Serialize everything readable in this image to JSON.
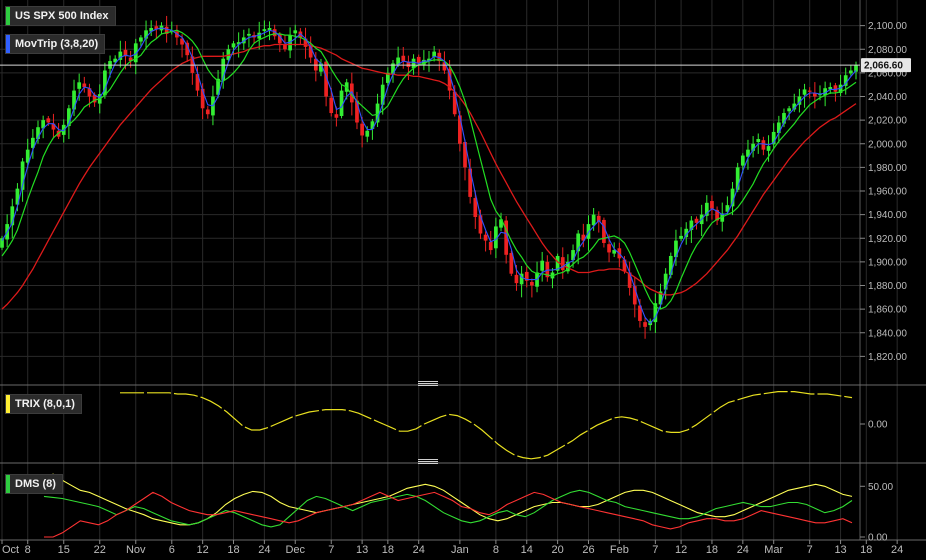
{
  "chart_data": [
    {
      "type": "candlestick",
      "title": "US SPX 500 Index",
      "overlay": "MovTrip (3,8,20)",
      "ylim": [
        1800,
        2120
      ],
      "yticks": [
        1820,
        1840,
        1860,
        1880,
        1900,
        1920,
        1940,
        1960,
        1980,
        2000,
        2020,
        2040,
        2060,
        2080,
        2100
      ],
      "ytick_labels": [
        "1,820.00",
        "1,840.00",
        "1,860.00",
        "1,880.00",
        "1,900.00",
        "1,920.00",
        "1,940.00",
        "1,960.00",
        "1,980.00",
        "2,000.00",
        "2,020.00",
        "2,040.00",
        "2,060.00",
        "2,080.00",
        "2,100.00"
      ],
      "last_price": 2066.6,
      "last_price_label": "2,066.60",
      "x_labels": [
        "Oct",
        "8",
        "15",
        "22",
        "Nov",
        "6",
        "12",
        "18",
        "24",
        "Dec",
        "7",
        "13",
        "18",
        "24",
        "Jan",
        "8",
        "14",
        "20",
        "26",
        "Feb",
        "7",
        "12",
        "18",
        "24",
        "Mar",
        "7",
        "13",
        "18",
        "24"
      ],
      "x_label_bar_index": [
        0,
        5,
        12,
        19,
        26,
        33,
        39,
        45,
        51,
        57,
        64,
        70,
        75,
        81,
        89,
        96,
        102,
        108,
        114,
        120,
        127,
        132,
        138,
        144,
        150,
        157,
        163,
        168,
        174
      ],
      "close": [
        1920,
        1932,
        1947,
        1962,
        1985,
        1995,
        2005,
        2014,
        2020,
        2018,
        2012,
        2006,
        2016,
        2030,
        2045,
        2052,
        2048,
        2040,
        2035,
        2042,
        2062,
        2070,
        2072,
        2078,
        2074,
        2070,
        2085,
        2090,
        2096,
        2098,
        2097,
        2100,
        2093,
        2096,
        2090,
        2084,
        2075,
        2060,
        2045,
        2030,
        2025,
        2040,
        2055,
        2072,
        2080,
        2085,
        2086,
        2090,
        2093,
        2090,
        2094,
        2097,
        2098,
        2091,
        2085,
        2080,
        2092,
        2096,
        2090,
        2082,
        2073,
        2062,
        2068,
        2040,
        2026,
        2022,
        2045,
        2052,
        2035,
        2018,
        2007,
        2011,
        2019,
        2034,
        2050,
        2060,
        2068,
        2073,
        2070,
        2065,
        2072,
        2068,
        2071,
        2072,
        2078,
        2070,
        2062,
        2045,
        2025,
        2000,
        1980,
        1955,
        1938,
        1924,
        1918,
        1910,
        1930,
        1936,
        1906,
        1890,
        1882,
        1890,
        1884,
        1880,
        1891,
        1901,
        1887,
        1891,
        1905,
        1893,
        1900,
        1910,
        1924,
        1918,
        1932,
        1940,
        1934,
        1916,
        1908,
        1910,
        1903,
        1892,
        1878,
        1864,
        1850,
        1845,
        1850,
        1865,
        1875,
        1890,
        1905,
        1918,
        1922,
        1928,
        1935,
        1933,
        1940,
        1950,
        1945,
        1935,
        1941,
        1948,
        1962,
        1980,
        1990,
        1995,
        2000,
        2004,
        1995,
        1998,
        2010,
        2018,
        2026,
        2030,
        2034,
        2040,
        2046,
        2044,
        2040,
        2042,
        2047,
        2048,
        2044,
        2050,
        2058,
        2062,
        2066.6
      ],
      "sma3": [
        1918,
        1925,
        1933,
        1947,
        1965,
        1981,
        1995,
        2005,
        2013,
        2017,
        2017,
        2012,
        2011,
        2017,
        2030,
        2042,
        2048,
        2047,
        2041,
        2039,
        2046,
        2058,
        2068,
        2073,
        2075,
        2074,
        2076,
        2082,
        2090,
        2095,
        2097,
        2098,
        2097,
        2096,
        2093,
        2090,
        2083,
        2073,
        2060,
        2045,
        2033,
        2032,
        2040,
        2056,
        2069,
        2079,
        2084,
        2087,
        2090,
        2091,
        2092,
        2094,
        2096,
        2095,
        2091,
        2085,
        2086,
        2089,
        2093,
        2089,
        2082,
        2072,
        2068,
        2057,
        2045,
        2029,
        2031,
        2040,
        2044,
        2035,
        2020,
        2012,
        2012,
        2021,
        2034,
        2048,
        2059,
        2067,
        2070,
        2069,
        2069,
        2068,
        2070,
        2070,
        2074,
        2073,
        2070,
        2059,
        2044,
        2023,
        2002,
        1978,
        1958,
        1939,
        1927,
        1917,
        1919,
        1925,
        1924,
        1911,
        1893,
        1887,
        1885,
        1885,
        1885,
        1891,
        1893,
        1893,
        1894,
        1896,
        1899,
        1901,
        1911,
        1917,
        1925,
        1930,
        1935,
        1930,
        1919,
        1911,
        1907,
        1902,
        1891,
        1878,
        1864,
        1853,
        1848,
        1853,
        1863,
        1877,
        1890,
        1904,
        1915,
        1923,
        1928,
        1932,
        1936,
        1941,
        1945,
        1943,
        1940,
        1941,
        1950,
        1963,
        1977,
        1988,
        1995,
        2000,
        2000,
        1999,
        2001,
        2009,
        2018,
        2025,
        2030,
        2035,
        2040,
        2043,
        2043,
        2042,
        2043,
        2046,
        2046,
        2047,
        2051,
        2057,
        2062
      ],
      "sma8": [
        1905,
        1911,
        1918,
        1927,
        1940,
        1953,
        1965,
        1976,
        1989,
        1998,
        2005,
        2009,
        2012,
        2016,
        2020,
        2025,
        2031,
        2034,
        2037,
        2038,
        2041,
        2046,
        2053,
        2060,
        2066,
        2070,
        2072,
        2075,
        2081,
        2086,
        2089,
        2093,
        2094,
        2095,
        2096,
        2094,
        2091,
        2087,
        2081,
        2072,
        2063,
        2057,
        2053,
        2053,
        2056,
        2060,
        2065,
        2071,
        2079,
        2085,
        2088,
        2090,
        2092,
        2093,
        2093,
        2092,
        2092,
        2091,
        2090,
        2088,
        2085,
        2081,
        2078,
        2071,
        2063,
        2056,
        2050,
        2048,
        2041,
        2036,
        2032,
        2028,
        2024,
        2025,
        2028,
        2032,
        2040,
        2048,
        2055,
        2060,
        2064,
        2067,
        2068,
        2070,
        2071,
        2071,
        2070,
        2066,
        2058,
        2048,
        2036,
        2021,
        2004,
        1987,
        1970,
        1953,
        1943,
        1937,
        1927,
        1918,
        1910,
        1904,
        1897,
        1892,
        1890,
        1890,
        1889,
        1888,
        1890,
        1891,
        1894,
        1898,
        1902,
        1904,
        1908,
        1913,
        1919,
        1920,
        1921,
        1922,
        1920,
        1916,
        1908,
        1898,
        1888,
        1877,
        1868,
        1862,
        1860,
        1862,
        1867,
        1875,
        1886,
        1896,
        1906,
        1914,
        1920,
        1927,
        1933,
        1936,
        1938,
        1940,
        1942,
        1946,
        1952,
        1959,
        1966,
        1975,
        1983,
        1989,
        1996,
        2002,
        2007,
        2012,
        2017,
        2023,
        2028,
        2033,
        2036,
        2039,
        2041,
        2043,
        2043,
        2044,
        2046,
        2049,
        2052
      ],
      "sma20": [
        1860,
        1864,
        1869,
        1874,
        1880,
        1887,
        1894,
        1902,
        1910,
        1918,
        1926,
        1934,
        1942,
        1950,
        1958,
        1966,
        1973,
        1980,
        1986,
        1992,
        1998,
        2004,
        2010,
        2016,
        2021,
        2026,
        2031,
        2036,
        2041,
        2046,
        2050,
        2054,
        2058,
        2062,
        2065,
        2068,
        2070,
        2072,
        2073,
        2074,
        2074,
        2074,
        2074,
        2074,
        2075,
        2076,
        2077,
        2078,
        2080,
        2081,
        2082,
        2083,
        2083,
        2084,
        2084,
        2084,
        2084,
        2084,
        2084,
        2084,
        2083,
        2082,
        2081,
        2079,
        2077,
        2075,
        2072,
        2070,
        2068,
        2066,
        2064,
        2063,
        2062,
        2061,
        2060,
        2059,
        2059,
        2058,
        2058,
        2058,
        2057,
        2057,
        2056,
        2055,
        2054,
        2053,
        2051,
        2048,
        2044,
        2039,
        2033,
        2026,
        2018,
        2010,
        2001,
        1992,
        1983,
        1975,
        1967,
        1959,
        1951,
        1944,
        1937,
        1930,
        1923,
        1916,
        1910,
        1905,
        1900,
        1897,
        1895,
        1893,
        1891,
        1891,
        1891,
        1892,
        1893,
        1893,
        1894,
        1894,
        1894,
        1892,
        1890,
        1887,
        1884,
        1880,
        1877,
        1875,
        1873,
        1872,
        1872,
        1873,
        1874,
        1876,
        1879,
        1882,
        1886,
        1890,
        1895,
        1900,
        1905,
        1910,
        1916,
        1922,
        1929,
        1936,
        1943,
        1950,
        1957,
        1963,
        1969,
        1975,
        1981,
        1987,
        1992,
        1997,
        2002,
        2006,
        2010,
        2014,
        2017,
        2020,
        2022,
        2025,
        2028,
        2031,
        2034
      ]
    },
    {
      "type": "line",
      "title": "TRIX (8,0,1)",
      "ytick_labels": [
        "0.00"
      ],
      "ylim": [
        -0.3,
        0.3
      ],
      "values": [
        0.26,
        0.26,
        0.26,
        0.26,
        0.26,
        0.26,
        0.26,
        0.25,
        0.25,
        0.24,
        0.22,
        0.19,
        0.15,
        0.1,
        0.04,
        -0.02,
        -0.05,
        -0.05,
        -0.03,
        0.0,
        0.03,
        0.06,
        0.08,
        0.1,
        0.11,
        0.12,
        0.12,
        0.12,
        0.11,
        0.09,
        0.06,
        0.03,
        0.0,
        -0.03,
        -0.06,
        -0.06,
        -0.04,
        0.0,
        0.03,
        0.06,
        0.08,
        0.07,
        0.04,
        0.0,
        -0.05,
        -0.11,
        -0.17,
        -0.22,
        -0.26,
        -0.28,
        -0.29,
        -0.28,
        -0.26,
        -0.22,
        -0.18,
        -0.14,
        -0.09,
        -0.05,
        -0.01,
        0.02,
        0.05,
        0.06,
        0.05,
        0.03,
        0.0,
        -0.03,
        -0.06,
        -0.07,
        -0.07,
        -0.05,
        -0.01,
        0.04,
        0.09,
        0.14,
        0.18,
        0.2,
        0.22,
        0.24,
        0.25,
        0.26,
        0.27,
        0.27,
        0.27,
        0.26,
        0.25,
        0.25,
        0.25,
        0.24,
        0.23,
        0.22
      ]
    },
    {
      "type": "line",
      "title": "DMS (8)",
      "ytick_labels": [
        "0.00",
        "50.00"
      ],
      "ylim": [
        0,
        70
      ],
      "series": [
        {
          "color": "#ffff55",
          "values": [
            58,
            62,
            56,
            51,
            46,
            44,
            40,
            36,
            32,
            28,
            25,
            22,
            18,
            16,
            14,
            12,
            12,
            14,
            18,
            24,
            32,
            38,
            42,
            45,
            44,
            40,
            34,
            30,
            28,
            26,
            24,
            26,
            28,
            30,
            32,
            34,
            36,
            38,
            40,
            44,
            48,
            50,
            52,
            50,
            46,
            40,
            34,
            28,
            22,
            18,
            16,
            18,
            22,
            26,
            30,
            32,
            34,
            34,
            32,
            30,
            30,
            32,
            36,
            40,
            44,
            46,
            46,
            44,
            40,
            36,
            32,
            28,
            24,
            22,
            20,
            20,
            22,
            26,
            30,
            34,
            38,
            42,
            46,
            48,
            50,
            52,
            50,
            46,
            42,
            40
          ]
        },
        {
          "color": "#33dd33",
          "values": [
            40,
            39,
            38,
            36,
            34,
            32,
            30,
            26,
            22,
            26,
            30,
            28,
            24,
            20,
            16,
            14,
            12,
            14,
            18,
            22,
            26,
            24,
            20,
            16,
            12,
            10,
            12,
            20,
            28,
            36,
            40,
            38,
            34,
            30,
            26,
            30,
            34,
            36,
            38,
            40,
            42,
            40,
            36,
            30,
            24,
            20,
            16,
            14,
            16,
            20,
            24,
            26,
            22,
            20,
            24,
            30,
            36,
            40,
            44,
            46,
            44,
            40,
            36,
            34,
            30,
            28,
            26,
            24,
            22,
            20,
            18,
            18,
            20,
            24,
            28,
            30,
            32,
            34,
            32,
            30,
            30,
            32,
            34,
            34,
            32,
            28,
            24,
            26,
            30,
            36
          ]
        },
        {
          "color": "#ff3333",
          "values": [
            0,
            0,
            4,
            10,
            16,
            14,
            12,
            16,
            22,
            26,
            32,
            38,
            44,
            40,
            34,
            30,
            26,
            24,
            22,
            22,
            24,
            26,
            24,
            22,
            20,
            18,
            16,
            14,
            16,
            20,
            24,
            26,
            28,
            30,
            32,
            36,
            40,
            44,
            40,
            36,
            38,
            40,
            42,
            44,
            40,
            36,
            30,
            28,
            24,
            22,
            26,
            32,
            36,
            40,
            44,
            42,
            38,
            34,
            32,
            30,
            28,
            26,
            24,
            22,
            20,
            18,
            16,
            12,
            10,
            8,
            10,
            14,
            16,
            18,
            18,
            16,
            16,
            18,
            22,
            26,
            24,
            22,
            20,
            18,
            16,
            14,
            14,
            16,
            18,
            14
          ]
        }
      ]
    }
  ]
}
